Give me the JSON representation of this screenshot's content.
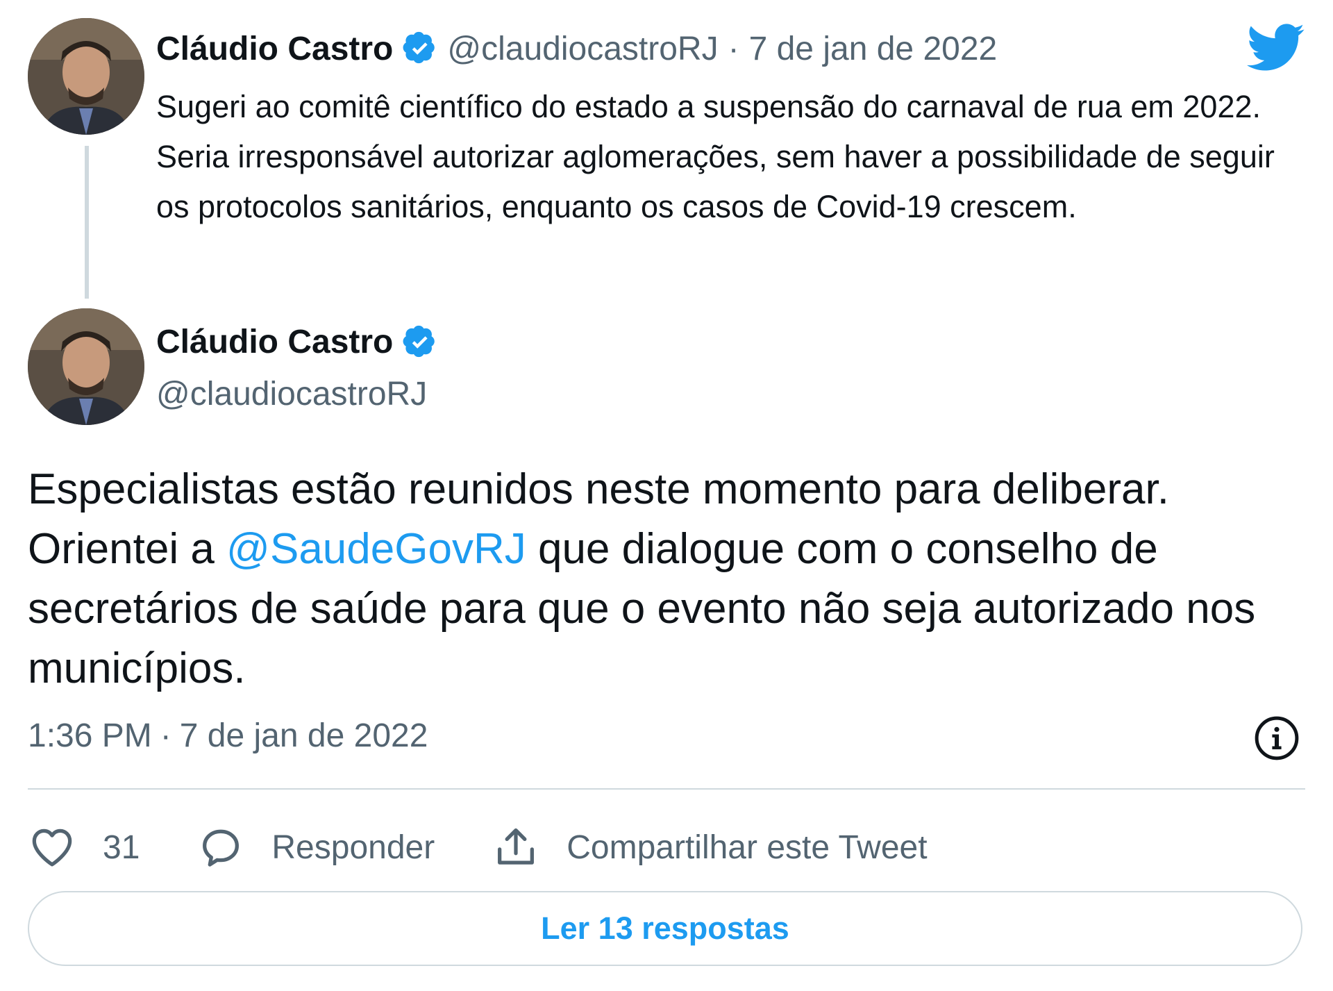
{
  "parent_tweet": {
    "author_name": "Cláudio Castro",
    "handle": "@claudiocastroRJ",
    "separator": "·",
    "date": "7 de jan de 2022",
    "text": "Sugeri ao comitê científico do estado a suspensão do carnaval de rua em 2022. Seria irresponsável autorizar aglomerações, sem haver a possibilidade de seguir os protocolos sanitários, enquanto os casos de Covid-19 crescem."
  },
  "main_tweet": {
    "author_name": "Cláudio Castro",
    "handle": "@claudiocastroRJ",
    "text_before": "Especialistas estão reunidos neste momento para deliberar. Orientei a ",
    "mention": "@SaudeGovRJ",
    "text_after": " que dialogue com o conselho de secretários de saúde para que o evento não seja autorizado nos municípios.",
    "time": "1:36 PM",
    "separator": "·",
    "date": "7 de jan de 2022"
  },
  "actions": {
    "like_count": "31",
    "reply_label": "Responder",
    "share_label": "Compartilhar este Tweet"
  },
  "read_replies_label": "Ler 13 respostas",
  "icons": {
    "brand": "twitter-bird-icon",
    "verified": "verified-badge-icon",
    "info": "info-icon",
    "like": "heart-icon",
    "reply": "speech-bubble-icon",
    "share": "share-upload-icon"
  },
  "colors": {
    "accent": "#1d9bf0",
    "text": "#0f1419",
    "secondary_text": "#536471",
    "border": "#cfd9de"
  }
}
